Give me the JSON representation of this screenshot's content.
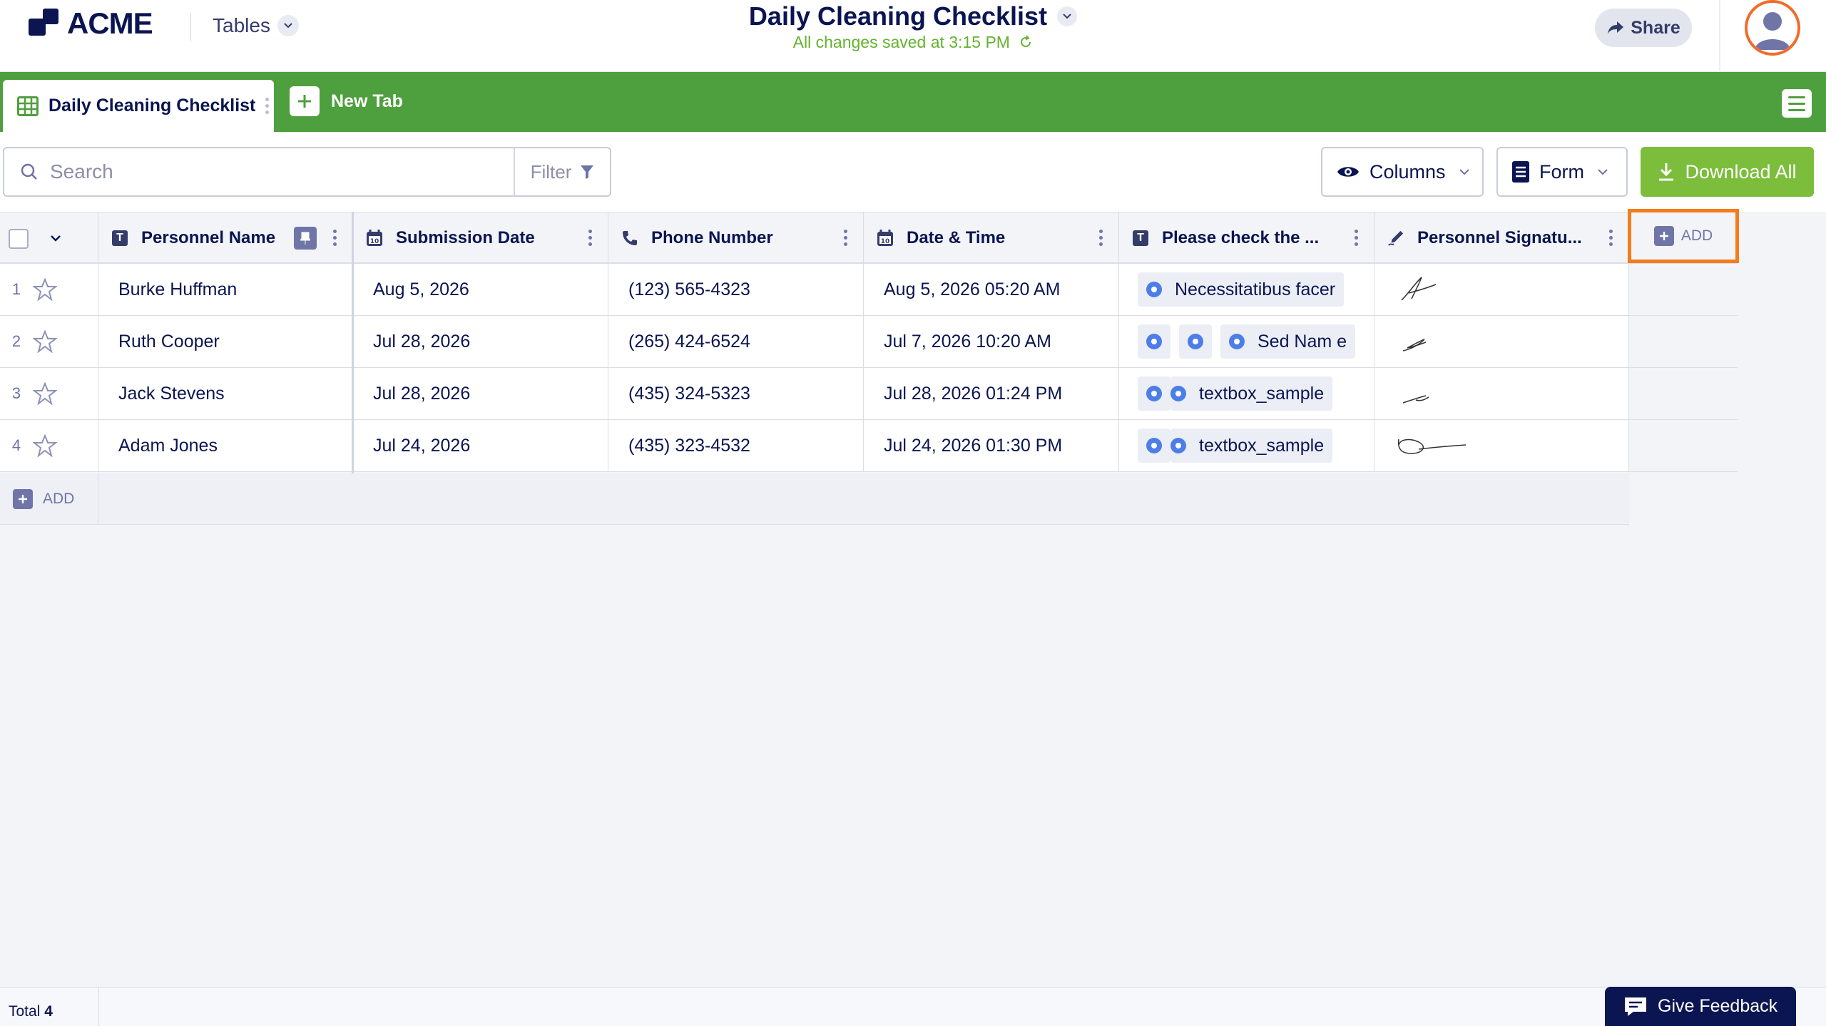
{
  "header": {
    "logo_text": "ACME",
    "tables_label": "Tables",
    "title": "Daily Cleaning Checklist",
    "saved_status": "All changes saved at 3:15 PM",
    "share_label": "Share"
  },
  "tabs": {
    "active_label": "Daily Cleaning Checklist",
    "new_tab_label": "New Tab"
  },
  "toolbar": {
    "search_placeholder": "Search",
    "filter_label": "Filter",
    "columns_label": "Columns",
    "form_label": "Form",
    "download_label": "Download All"
  },
  "table": {
    "columns": [
      {
        "label": "Personnel Name",
        "icon": "text-type-icon"
      },
      {
        "label": "Submission Date",
        "icon": "calendar-icon"
      },
      {
        "label": "Phone Number",
        "icon": "phone-icon"
      },
      {
        "label": "Date & Time",
        "icon": "calendar-icon"
      },
      {
        "label": "Please check the ...",
        "icon": "text-type-icon"
      },
      {
        "label": "Personnel Signatu...",
        "icon": "signature-pen-icon"
      }
    ],
    "add_column_label": "ADD",
    "add_row_label": "ADD",
    "rows": [
      {
        "num": "1",
        "name": "Burke Huffman",
        "submission": "Aug 5, 2026",
        "phone": "(123) 565-4323",
        "datetime": "Aug 5, 2026 05:20 AM",
        "check_text": "Necessitatibus facer"
      },
      {
        "num": "2",
        "name": "Ruth Cooper",
        "submission": "Jul 28, 2026",
        "phone": "(265) 424-6524",
        "datetime": "Jul 7, 2026 10:20 AM",
        "check_text": "Sed Nam e"
      },
      {
        "num": "3",
        "name": "Jack Stevens",
        "submission": "Jul 28, 2026",
        "phone": "(435) 324-5323",
        "datetime": "Jul 28, 2026 01:24 PM",
        "check_text": "textbox_sample"
      },
      {
        "num": "4",
        "name": "Adam Jones",
        "submission": "Jul 24, 2026",
        "phone": "(435) 323-4532",
        "datetime": "Jul 24, 2026 01:30 PM",
        "check_text": "textbox_sample"
      }
    ]
  },
  "footer": {
    "total_label": "Total",
    "total_count": "4",
    "feedback_label": "Give Feedback"
  },
  "colors": {
    "brand_navy": "#0a1551",
    "tab_green": "#4e9f3d",
    "download_green": "#7cbd3b",
    "highlight_orange": "#f57c1a",
    "radio_blue": "#4d7ee8"
  }
}
